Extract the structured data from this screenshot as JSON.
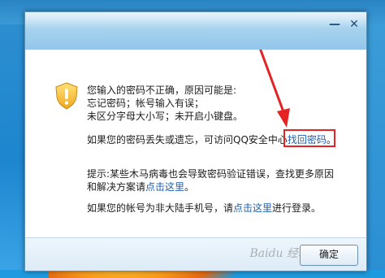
{
  "window": {
    "minimize_label": "—",
    "close_label": "✕"
  },
  "message": {
    "line1": "您输入的密码不正确，原因可能是:",
    "line2": "忘记密码；帐号输入有误；",
    "line3": "未区分字母大小写；未开启小键盘。",
    "lost_password_prefix": "如果您的密码丢失或遗忘，可访问QQ安全中心",
    "find_password_link": "找回密码",
    "lost_password_suffix": "。",
    "tip_prefix": "提示:某些木马病毒也会导致密码验证错误，查找更多原因",
    "tip_line2_prefix": "和解决方案请",
    "tip_link": "点击这里",
    "tip_suffix": "。",
    "non_mainland_prefix": "如果您的帐号为非大陆手机号，请",
    "non_mainland_link": "点击这里",
    "non_mainland_suffix": "进行登录。"
  },
  "footer": {
    "confirm_label": "确定",
    "watermark": "Baidu 经验"
  },
  "colors": {
    "link": "#1f5fb0",
    "highlight": "#e42424",
    "desktop": "#1e9be0"
  }
}
